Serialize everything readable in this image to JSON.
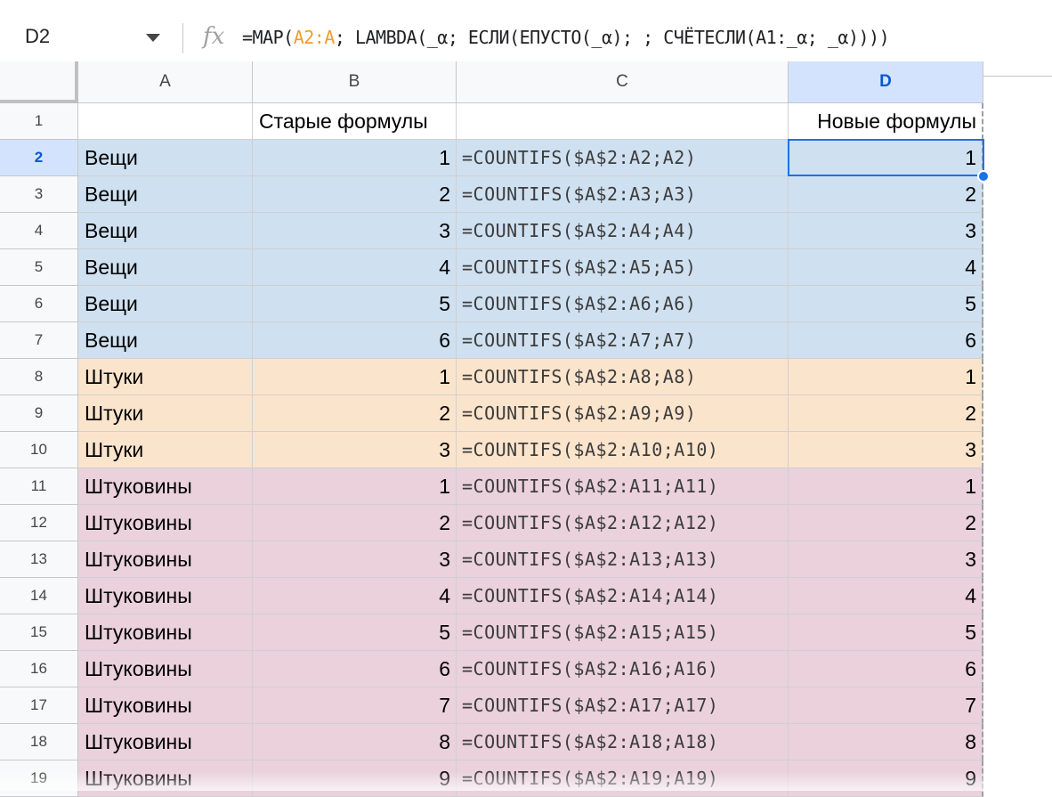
{
  "formula_bar": {
    "name_box": "D2",
    "fx_label": "fx",
    "formula_prefix": "=MAP(",
    "formula_ref": "A2:A",
    "formula_suffix": "; LAMBDA(_α; ЕСЛИ(ЕПУСТО(_α); ; СЧЁТЕСЛИ(A1:_α; _α))))"
  },
  "columns": [
    "A",
    "B",
    "C",
    "D"
  ],
  "selected_column": "D",
  "selected_row": "2",
  "header_row": {
    "row": "1",
    "a": "",
    "b": "Старые формулы",
    "c": "",
    "d": "Новые формулы"
  },
  "rows": [
    {
      "row": "2",
      "a": "Вещи",
      "b": "1",
      "c": "=COUNTIFS($A$2:A2;A2)",
      "d": "1",
      "group": "veshchi"
    },
    {
      "row": "3",
      "a": "Вещи",
      "b": "2",
      "c": "=COUNTIFS($A$2:A3;A3)",
      "d": "2",
      "group": "veshchi"
    },
    {
      "row": "4",
      "a": "Вещи",
      "b": "3",
      "c": "=COUNTIFS($A$2:A4;A4)",
      "d": "3",
      "group": "veshchi"
    },
    {
      "row": "5",
      "a": "Вещи",
      "b": "4",
      "c": "=COUNTIFS($A$2:A5;A5)",
      "d": "4",
      "group": "veshchi"
    },
    {
      "row": "6",
      "a": "Вещи",
      "b": "5",
      "c": "=COUNTIFS($A$2:A6;A6)",
      "d": "5",
      "group": "veshchi"
    },
    {
      "row": "7",
      "a": "Вещи",
      "b": "6",
      "c": "=COUNTIFS($A$2:A7;A7)",
      "d": "6",
      "group": "veshchi"
    },
    {
      "row": "8",
      "a": "Штуки",
      "b": "1",
      "c": "=COUNTIFS($A$2:A8;A8)",
      "d": "1",
      "group": "shtuki"
    },
    {
      "row": "9",
      "a": "Штуки",
      "b": "2",
      "c": "=COUNTIFS($A$2:A9;A9)",
      "d": "2",
      "group": "shtuki"
    },
    {
      "row": "10",
      "a": "Штуки",
      "b": "3",
      "c": "=COUNTIFS($A$2:A10;A10)",
      "d": "3",
      "group": "shtuki"
    },
    {
      "row": "11",
      "a": "Штуковины",
      "b": "1",
      "c": "=COUNTIFS($A$2:A11;A11)",
      "d": "1",
      "group": "shtukoviny"
    },
    {
      "row": "12",
      "a": "Штуковины",
      "b": "2",
      "c": "=COUNTIFS($A$2:A12;A12)",
      "d": "2",
      "group": "shtukoviny"
    },
    {
      "row": "13",
      "a": "Штуковины",
      "b": "3",
      "c": "=COUNTIFS($A$2:A13;A13)",
      "d": "3",
      "group": "shtukoviny"
    },
    {
      "row": "14",
      "a": "Штуковины",
      "b": "4",
      "c": "=COUNTIFS($A$2:A14;A14)",
      "d": "4",
      "group": "shtukoviny"
    },
    {
      "row": "15",
      "a": "Штуковины",
      "b": "5",
      "c": "=COUNTIFS($A$2:A15;A15)",
      "d": "5",
      "group": "shtukoviny"
    },
    {
      "row": "16",
      "a": "Штуковины",
      "b": "6",
      "c": "=COUNTIFS($A$2:A16;A16)",
      "d": "6",
      "group": "shtukoviny"
    },
    {
      "row": "17",
      "a": "Штуковины",
      "b": "7",
      "c": "=COUNTIFS($A$2:A17;A17)",
      "d": "7",
      "group": "shtukoviny"
    },
    {
      "row": "18",
      "a": "Штуковины",
      "b": "8",
      "c": "=COUNTIFS($A$2:A18;A18)",
      "d": "8",
      "group": "shtukoviny"
    },
    {
      "row": "19",
      "a": "Штуковины",
      "b": "9",
      "c": "=COUNTIFS($A$2:A19;A19)",
      "d": "9",
      "group": "shtukoviny"
    }
  ],
  "group_colors": {
    "veshchi": "#cfe0f0",
    "shtuki": "#fbe4cc",
    "shtukoviny": "#ead1dc"
  }
}
